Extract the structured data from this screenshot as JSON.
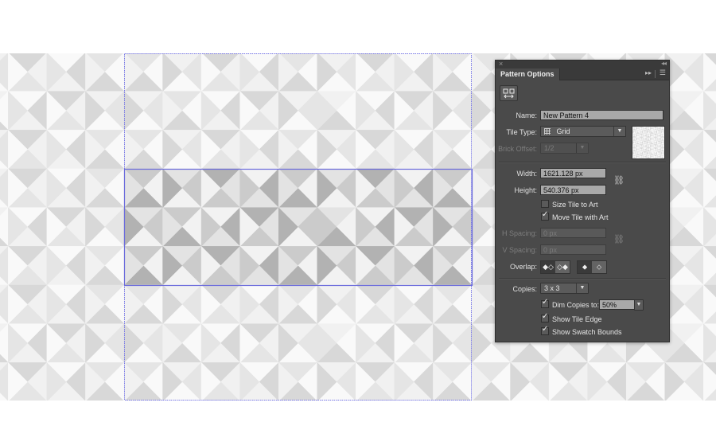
{
  "canvas": {
    "pattern_colors_full": [
      "#f2f2f2",
      "#e3e3e3",
      "#cbcbcb",
      "#b2b2b2"
    ],
    "pattern_colors_dimmed": [
      "#f9f9f9",
      "#f1f1f1",
      "#e5e5e5",
      "#d8d8d8"
    ],
    "tile_edge_color": "#6b6bdc",
    "swatch_bounds_color": "#7a7ae6",
    "tile_grid": {
      "rows": 3,
      "cols": 9,
      "cells_top_right_bottom_left": [
        [
          [
            2,
            0,
            3,
            1
          ],
          [
            1,
            2,
            0,
            3
          ],
          [
            3,
            1,
            2,
            0
          ],
          [
            0,
            3,
            1,
            2
          ],
          [
            2,
            0,
            3,
            1
          ],
          [
            1,
            2,
            0,
            3
          ],
          [
            3,
            1,
            2,
            0
          ],
          [
            0,
            3,
            1,
            2
          ],
          [
            2,
            0,
            3,
            1
          ]
        ],
        [
          [
            1,
            2,
            0,
            3
          ],
          [
            2,
            0,
            3,
            1
          ],
          [
            0,
            3,
            1,
            2
          ],
          [
            3,
            1,
            2,
            0
          ],
          [
            1,
            2,
            0,
            3
          ],
          [
            1,
            0,
            3,
            2
          ],
          [
            0,
            3,
            1,
            2
          ],
          [
            3,
            1,
            2,
            0
          ],
          [
            1,
            2,
            0,
            3
          ]
        ],
        [
          [
            2,
            0,
            3,
            1
          ],
          [
            1,
            2,
            0,
            3
          ],
          [
            3,
            1,
            2,
            0
          ],
          [
            0,
            3,
            1,
            2
          ],
          [
            2,
            0,
            3,
            1
          ],
          [
            1,
            2,
            0,
            3
          ],
          [
            3,
            1,
            2,
            0
          ],
          [
            0,
            3,
            1,
            2
          ],
          [
            2,
            0,
            3,
            1
          ]
        ]
      ]
    }
  },
  "panel": {
    "close_icon": "×",
    "collapse_icon": "◂◂",
    "tab_label": "Pattern Options",
    "forward_icon": "▸▸",
    "menu_icon": "☰",
    "name_label": "Name:",
    "name_value": "New Pattern 4",
    "tile_type_label": "Tile Type:",
    "tile_type_value": "Grid",
    "tile_type_icon": "grid-icon",
    "brick_offset_label": "Brick Offset:",
    "brick_offset_value": "1/2",
    "width_label": "Width:",
    "width_value": "1621.128 px",
    "height_label": "Height:",
    "height_value": "540.376 px",
    "size_tile_to_art_label": "Size Tile to Art",
    "size_tile_to_art_checked": false,
    "move_tile_with_art_label": "Move Tile with Art",
    "move_tile_with_art_checked": true,
    "h_spacing_label": "H Spacing:",
    "h_spacing_value": "0 px",
    "v_spacing_label": "V Spacing:",
    "v_spacing_value": "0 px",
    "overlap_label": "Overlap:",
    "copies_label": "Copies:",
    "copies_value": "3 x 3",
    "dim_copies_label": "Dim Copies to:",
    "dim_copies_checked": true,
    "dim_copies_value": "50%",
    "show_tile_edge_label": "Show Tile Edge",
    "show_tile_edge_checked": true,
    "show_swatch_bounds_label": "Show Swatch Bounds",
    "show_swatch_bounds_checked": true,
    "dropdown_arrow": "▼",
    "check_glyph": "✓",
    "link_glyph": "⛓"
  }
}
